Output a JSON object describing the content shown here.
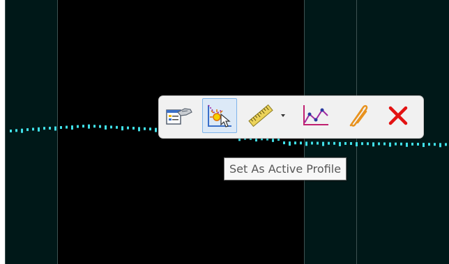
{
  "toolbar": {
    "tools": [
      {
        "name": "profile-properties",
        "icon": "hand-properties-icon"
      },
      {
        "name": "set-as-active-profile",
        "icon": "active-profile-icon",
        "active": true
      },
      {
        "name": "measure",
        "icon": "ruler-icon",
        "has_dropdown": true
      },
      {
        "name": "profile-graph",
        "icon": "profile-graph-icon"
      },
      {
        "name": "attach",
        "icon": "paperclip-icon"
      },
      {
        "name": "delete",
        "icon": "red-x-icon"
      }
    ]
  },
  "tooltip": {
    "text": "Set As Active Profile"
  },
  "colors": {
    "viewport_background": "#001818",
    "panel_background": "#000000",
    "profile_dots": "#40e0e8",
    "toolbar_background": "#f1f1f1",
    "active_tool_highlight": "#dce9f7",
    "delete_red": "#e31212"
  }
}
